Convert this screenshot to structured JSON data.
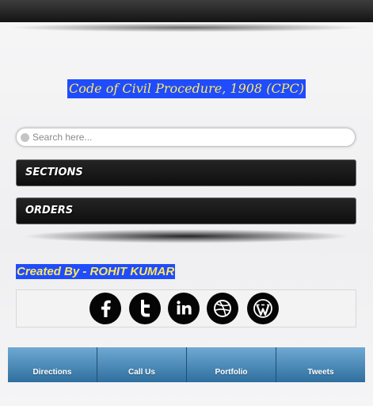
{
  "header": {
    "title": "Code of Civil Procedure, 1908 (CPC)"
  },
  "search": {
    "placeholder": "Search here..."
  },
  "menu": {
    "items": [
      {
        "label": "SECTIONS"
      },
      {
        "label": "ORDERS"
      }
    ]
  },
  "credit": {
    "text": "Created By - ROHIT KUMAR"
  },
  "social": {
    "icons": [
      "facebook-icon",
      "twitter-icon",
      "linkedin-icon",
      "dribbble-icon",
      "wordpress-icon"
    ]
  },
  "nav": {
    "items": [
      {
        "label": "Directions"
      },
      {
        "label": "Call Us"
      },
      {
        "label": "Portfolio"
      },
      {
        "label": "Tweets"
      }
    ]
  },
  "colors": {
    "title_bg": "#1f4cff",
    "title_text": "#ffe95a",
    "menu_bg": "#141414",
    "nav_bg": "#4a8bbd",
    "top_bar": "#1a1a1a"
  }
}
